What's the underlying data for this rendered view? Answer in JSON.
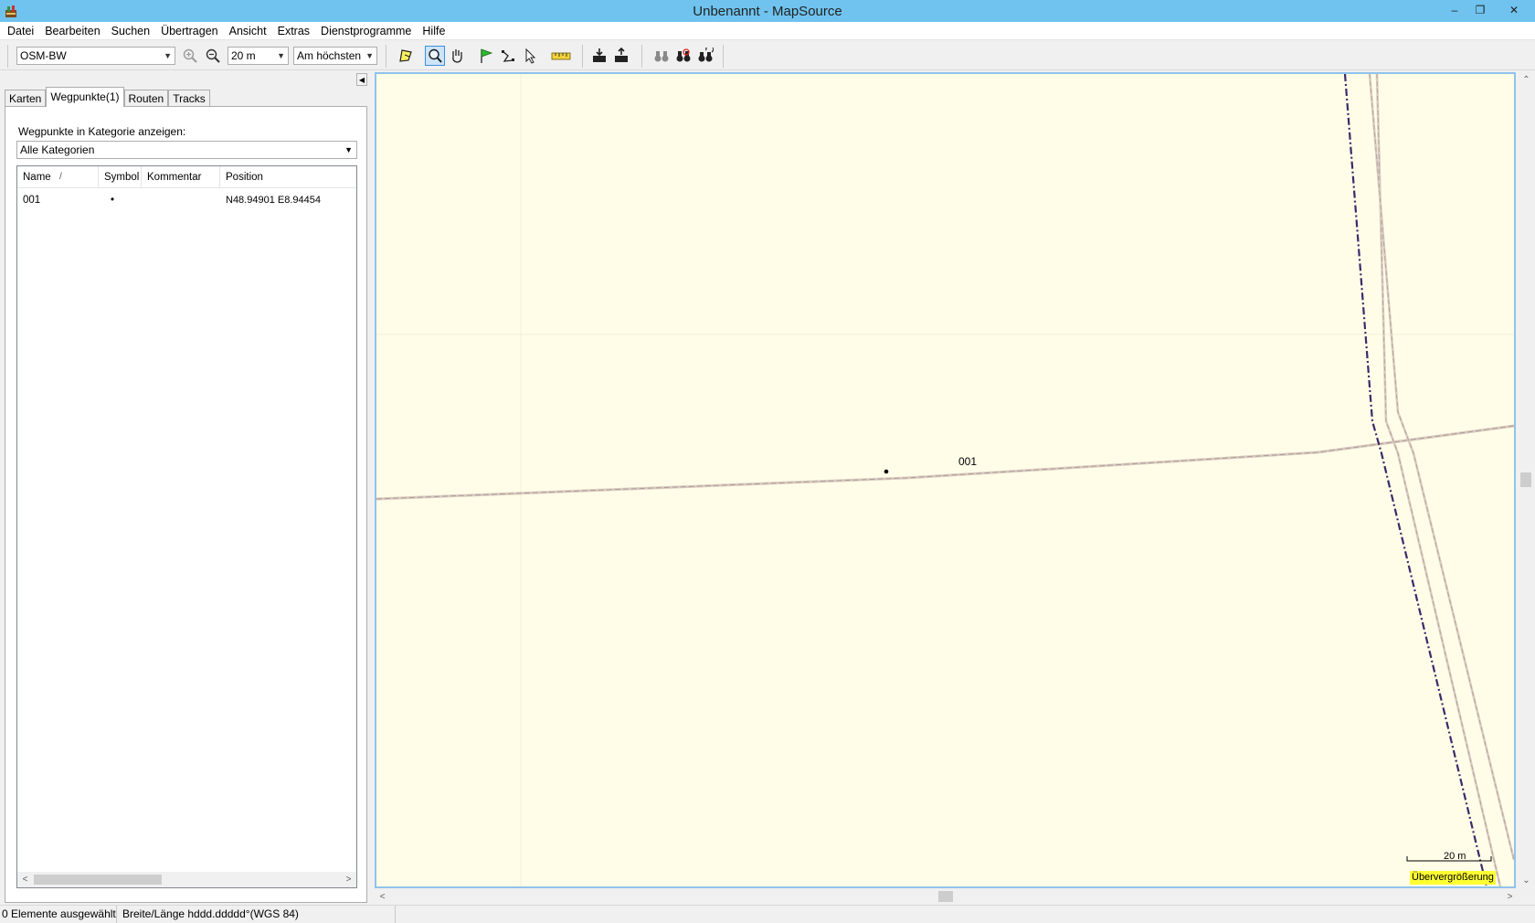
{
  "window": {
    "title": "Unbenannt - MapSource",
    "minimize": "–",
    "maximize": "❐",
    "close": "✕"
  },
  "menu": [
    "Datei",
    "Bearbeiten",
    "Suchen",
    "Übertragen",
    "Ansicht",
    "Extras",
    "Dienstprogramme",
    "Hilfe"
  ],
  "toolbar": {
    "map_product": "OSM-BW",
    "zoom_level": "20 m",
    "detail_level": "Am höchsten",
    "active_tool": "zoom-tool"
  },
  "left_panel": {
    "tabs": [
      "Karten",
      "Wegpunkte(1)",
      "Routen",
      "Tracks"
    ],
    "active_tab": "Wegpunkte(1)",
    "category_label": "Wegpunkte in Kategorie anzeigen:",
    "category_value": "Alle Kategorien",
    "columns": [
      "Name",
      "Symbol",
      "Kommentar",
      "Position"
    ],
    "sort_indicator": "/",
    "rows": [
      {
        "name": "001",
        "symbol": "•",
        "comment": "",
        "position": "N48.94901 E8.94454"
      }
    ]
  },
  "map": {
    "waypoint_label": "001",
    "scale_label": "20 m",
    "overzoom_label": "Übervergrößerung",
    "background_color": "#fffde8"
  },
  "status": {
    "selection": "0 Elemente ausgewählt",
    "format": "Breite/Länge hddd.ddddd°(WGS 84)",
    "extra": ""
  }
}
